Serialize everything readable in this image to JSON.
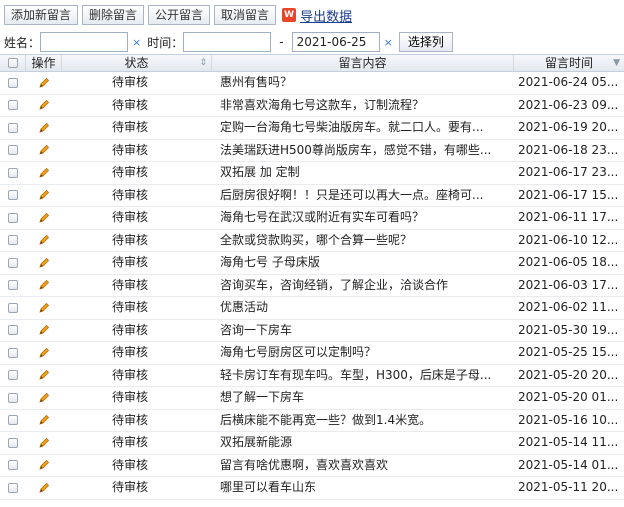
{
  "toolbar": {
    "add": "添加新留言",
    "delete": "删除留言",
    "publish": "公开留言",
    "cancel": "取消留言",
    "export_icon": "xls-icon",
    "export_icon_text": "W",
    "export": "导出数据"
  },
  "filter": {
    "name_label": "姓名：",
    "name_value": "",
    "clear": "×",
    "time_label": "时间：",
    "time_from": "",
    "dash": "-",
    "time_to": "2021-06-25",
    "select_columns": "选择列"
  },
  "grid": {
    "headers": {
      "op": "操作",
      "status": "状态",
      "content": "留言内容",
      "time": "留言时间"
    },
    "rows": [
      {
        "status": "待审核",
        "content": "惠州有售吗？",
        "time": "2021-06-24 05..."
      },
      {
        "status": "待审核",
        "content": "非常喜欢海角七号这款车，订制流程？",
        "time": "2021-06-23 09..."
      },
      {
        "status": "待审核",
        "content": "定购一台海角七号柴油版房车。就二口人。要有...",
        "time": "2021-06-19 20..."
      },
      {
        "status": "待审核",
        "content": "法美瑞跃进H500尊尚版房车，感觉不错，有哪些...",
        "time": "2021-06-18 23..."
      },
      {
        "status": "待审核",
        "content": "双拓展 加 定制",
        "time": "2021-06-17 23..."
      },
      {
        "status": "待审核",
        "content": "后厨房很好啊！！只是还可以再大一点。座椅可...",
        "time": "2021-06-17 15..."
      },
      {
        "status": "待审核",
        "content": "海角七号在武汉或附近有实车可看吗？",
        "time": "2021-06-11 17..."
      },
      {
        "status": "待审核",
        "content": "全款或贷款购买，哪个合算一些呢？",
        "time": "2021-06-10 12..."
      },
      {
        "status": "待审核",
        "content": "海角七号 子母床版",
        "time": "2021-06-05 18..."
      },
      {
        "status": "待审核",
        "content": "咨询买车，咨询经销，了解企业，洽谈合作",
        "time": "2021-06-03 17..."
      },
      {
        "status": "待审核",
        "content": "优惠活动",
        "time": "2021-06-02 11..."
      },
      {
        "status": "待审核",
        "content": "咨询一下房车",
        "time": "2021-05-30 19..."
      },
      {
        "status": "待审核",
        "content": "海角七号厨房区可以定制吗？",
        "time": "2021-05-25 15..."
      },
      {
        "status": "待审核",
        "content": "轻卡房订车有现车吗。车型，H300，后床是子母...",
        "time": "2021-05-20 20..."
      },
      {
        "status": "待审核",
        "content": "想了解一下房车",
        "time": "2021-05-20 01..."
      },
      {
        "status": "待审核",
        "content": "后横床能不能再宽一些？做到1.4米宽。",
        "time": "2021-05-16 10..."
      },
      {
        "status": "待审核",
        "content": "双拓展新能源",
        "time": "2021-05-14 11..."
      },
      {
        "status": "待审核",
        "content": "留言有啥优惠啊，喜欢喜欢喜欢",
        "time": "2021-05-14 01..."
      },
      {
        "status": "待审核",
        "content": "哪里可以看车山东",
        "time": "2021-05-11 20..."
      }
    ]
  },
  "colors": {
    "accent": "#e8452b",
    "link": "#1a3e8c",
    "clear": "#3a7bd5"
  }
}
